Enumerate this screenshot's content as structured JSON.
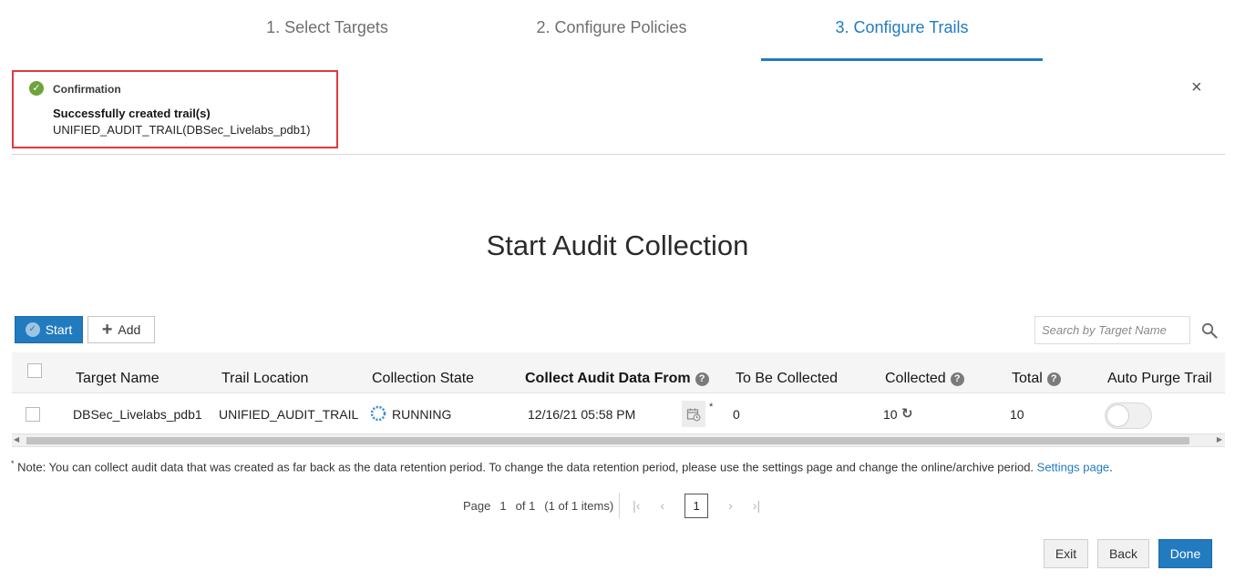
{
  "steps": [
    {
      "label": "1. Select Targets"
    },
    {
      "label": "2. Configure Policies"
    },
    {
      "label": "3. Configure Trails"
    }
  ],
  "confirmation": {
    "title": "Confirmation",
    "message": "Successfully created trail(s)",
    "detail": "UNIFIED_AUDIT_TRAIL(DBSec_Livelabs_pdb1)",
    "close_glyph": "×"
  },
  "page_title": "Start Audit Collection",
  "toolbar": {
    "start_label": "Start",
    "add_label": "Add",
    "search_placeholder": "Search by Target Name"
  },
  "table": {
    "columns": [
      "Target Name",
      "Trail Location",
      "Collection State",
      "Collect Audit Data From",
      "To Be Collected",
      "Collected",
      "Total",
      "Auto Purge Trail"
    ],
    "rows": [
      {
        "target_name": "DBSec_Livelabs_pdb1",
        "trail_location": "UNIFIED_AUDIT_TRAIL",
        "collection_state": "RUNNING",
        "collect_from": "12/16/21 05:58 PM",
        "asterisk": "*",
        "to_be_collected": "0",
        "collected": "10",
        "total": "10",
        "auto_purge": false
      }
    ]
  },
  "note": {
    "asterisk": "*",
    "text": " Note: You can collect audit data that was created as far back as the data retention period. To change the data retention period, please use the settings page and change the online/archive period. ",
    "link": "Settings page",
    "suffix": "."
  },
  "pagination": {
    "page_label": "Page",
    "current_page": "1",
    "of_label": "of 1",
    "items": "(1 of 1 items)",
    "page_box": "1"
  },
  "footer": {
    "exit": "Exit",
    "back": "Back",
    "done": "Done"
  },
  "colors": {
    "accent": "#227bbf",
    "success": "#6fa33d",
    "highlight_border": "#e0393e"
  }
}
